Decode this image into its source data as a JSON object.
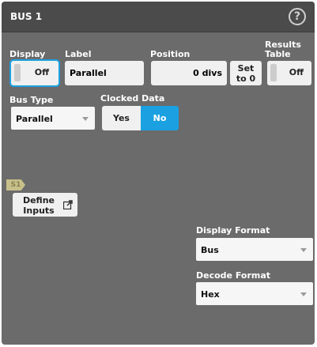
{
  "title": "BUS 1",
  "help_icon": "question-circle-icon",
  "display": {
    "label": "Display",
    "value": "Off"
  },
  "label_field": {
    "label": "Label",
    "value": "Parallel"
  },
  "position": {
    "label": "Position",
    "value": "0 divs",
    "set_button_line1": "Set",
    "set_button_line2": "to 0"
  },
  "results_table": {
    "label_line1": "Results",
    "label_line2": "Table",
    "value": "Off"
  },
  "bus_type": {
    "label": "Bus Type",
    "value": "Parallel"
  },
  "clocked_data": {
    "label": "Clocked Data",
    "options": [
      "Yes",
      "No"
    ],
    "selected": "No"
  },
  "s1_marker": "S1",
  "define_inputs": {
    "line1": "Define",
    "line2": "Inputs",
    "icon": "external-link-icon"
  },
  "display_format": {
    "label": "Display Format",
    "value": "Bus"
  },
  "decode_format": {
    "label": "Decode Format",
    "value": "Hex"
  },
  "colors": {
    "accent": "#1ba1e2",
    "panel": "#6b6b6b",
    "titlebar": "#4b4b4b"
  }
}
